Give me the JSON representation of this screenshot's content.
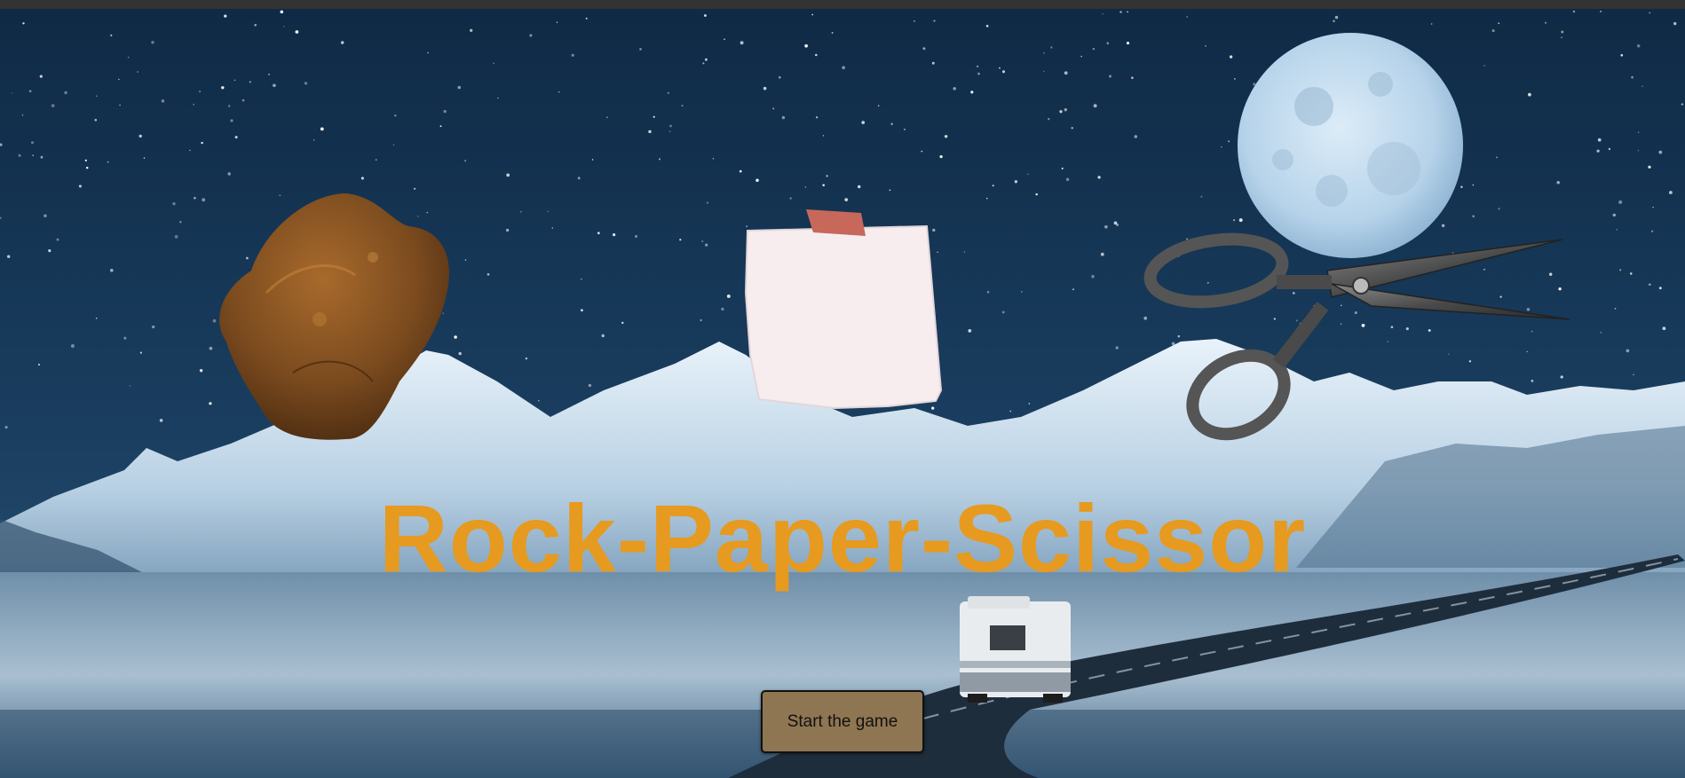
{
  "game": {
    "title": "Rock-Paper-Scissor",
    "start_button_label": "Start the game"
  },
  "choices": [
    {
      "name": "rock",
      "icon": "rock-image"
    },
    {
      "name": "paper",
      "icon": "paper-image"
    },
    {
      "name": "scissor",
      "icon": "scissor-image"
    }
  ],
  "colors": {
    "title": "#e69a1f",
    "button": "#8f7652",
    "sky": "#143454",
    "top_bar": "#333333"
  }
}
